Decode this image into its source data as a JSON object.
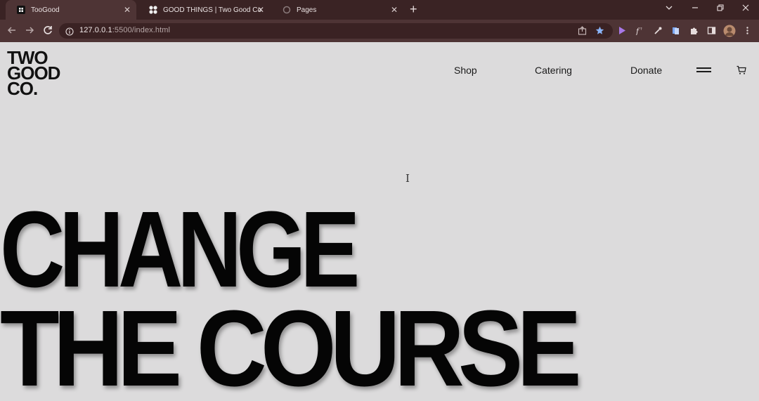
{
  "browser": {
    "tabs": [
      {
        "title": "TooGood",
        "active": true,
        "close": "✕"
      },
      {
        "title": "GOOD THINGS | Two Good Co",
        "active": false,
        "close": "✕"
      },
      {
        "title": "Pages",
        "active": false,
        "close": "✕"
      }
    ],
    "new_tab": "+",
    "url_host": "127.0.0.1",
    "url_path": ":5500/index.html"
  },
  "site": {
    "logo": [
      "TWO",
      "GOOD",
      "CO."
    ],
    "nav": {
      "shop": "Shop",
      "catering": "Catering",
      "donate": "Donate"
    },
    "icons": {
      "menu": "hamburger-menu-icon",
      "cart": "cart-icon"
    }
  },
  "hero": {
    "line1": "CHANGE",
    "line2": "THE COURSE"
  }
}
